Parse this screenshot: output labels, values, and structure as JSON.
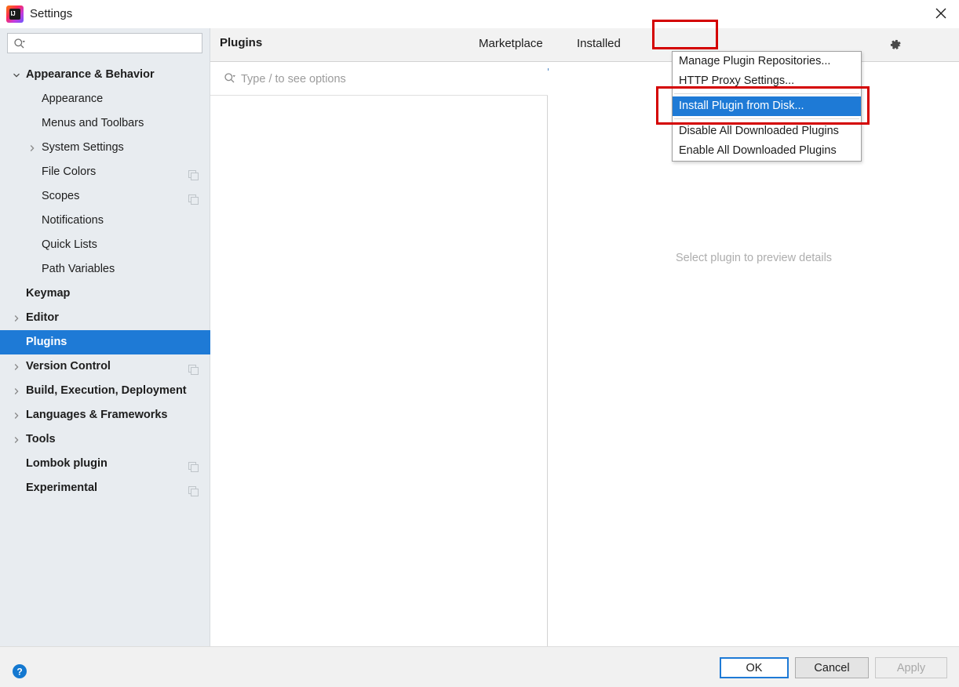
{
  "window": {
    "title": "Settings",
    "logo_icon": "intellij-idea-logo",
    "close_icon": "close-icon"
  },
  "sidebar": {
    "search": {
      "value": "",
      "placeholder": "",
      "icon": "search-icon"
    },
    "items": [
      {
        "label": "Appearance & Behavior",
        "bold": true,
        "indent": 33,
        "arrow": "down",
        "copy": false,
        "selected": false
      },
      {
        "label": "Appearance",
        "bold": false,
        "indent": 53,
        "arrow": "none",
        "copy": false,
        "selected": false
      },
      {
        "label": "Menus and Toolbars",
        "bold": false,
        "indent": 53,
        "arrow": "none",
        "copy": false,
        "selected": false
      },
      {
        "label": "System Settings",
        "bold": false,
        "indent": 53,
        "arrow": "right",
        "copy": false,
        "selected": false
      },
      {
        "label": "File Colors",
        "bold": false,
        "indent": 53,
        "arrow": "none",
        "copy": true,
        "selected": false
      },
      {
        "label": "Scopes",
        "bold": false,
        "indent": 53,
        "arrow": "none",
        "copy": true,
        "selected": false
      },
      {
        "label": "Notifications",
        "bold": false,
        "indent": 53,
        "arrow": "none",
        "copy": false,
        "selected": false
      },
      {
        "label": "Quick Lists",
        "bold": false,
        "indent": 53,
        "arrow": "none",
        "copy": false,
        "selected": false
      },
      {
        "label": "Path Variables",
        "bold": false,
        "indent": 53,
        "arrow": "none",
        "copy": false,
        "selected": false
      },
      {
        "label": "Keymap",
        "bold": true,
        "indent": 33,
        "arrow": "none",
        "copy": false,
        "selected": false
      },
      {
        "label": "Editor",
        "bold": true,
        "indent": 33,
        "arrow": "right",
        "copy": false,
        "selected": false
      },
      {
        "label": "Plugins",
        "bold": true,
        "indent": 33,
        "arrow": "none",
        "copy": false,
        "selected": true
      },
      {
        "label": "Version Control",
        "bold": true,
        "indent": 33,
        "arrow": "right",
        "copy": true,
        "selected": false
      },
      {
        "label": "Build, Execution, Deployment",
        "bold": true,
        "indent": 33,
        "arrow": "right",
        "copy": false,
        "selected": false
      },
      {
        "label": "Languages & Frameworks",
        "bold": true,
        "indent": 33,
        "arrow": "right",
        "copy": false,
        "selected": false
      },
      {
        "label": "Tools",
        "bold": true,
        "indent": 33,
        "arrow": "right",
        "copy": false,
        "selected": false
      },
      {
        "label": "Lombok plugin",
        "bold": true,
        "indent": 33,
        "arrow": "none",
        "copy": true,
        "selected": false
      },
      {
        "label": "Experimental",
        "bold": true,
        "indent": 33,
        "arrow": "none",
        "copy": true,
        "selected": false
      }
    ]
  },
  "plugins": {
    "header_title": "Plugins",
    "tabs": [
      {
        "label": "Marketplace",
        "active": true
      },
      {
        "label": "Installed",
        "active": false
      }
    ],
    "gear_icon": "gear-icon",
    "search": {
      "value": "",
      "placeholder": "Type / to see options",
      "icon": "search-icon"
    },
    "loading_icon": "loading-spinner-icon",
    "detail_message": "Select plugin to preview details"
  },
  "gear_menu": {
    "items": [
      {
        "label": "Manage Plugin Repositories...",
        "highlighted": false,
        "separator_after": false
      },
      {
        "label": "HTTP Proxy Settings...",
        "highlighted": false,
        "separator_after": true
      },
      {
        "label": "Install Plugin from Disk...",
        "highlighted": true,
        "separator_after": true
      },
      {
        "label": "Disable All Downloaded Plugins",
        "highlighted": false,
        "separator_after": false
      },
      {
        "label": "Enable All Downloaded Plugins",
        "highlighted": false,
        "separator_after": false
      }
    ]
  },
  "footer": {
    "help_icon": "help-icon",
    "ok_label": "OK",
    "cancel_label": "Cancel",
    "apply_label": "Apply"
  },
  "colors": {
    "accent": "#1e7ad6",
    "sidebar_bg": "#e8ecf0",
    "annotation": "#d40000",
    "tab_underline": "#4b86c7",
    "placeholder": "#9b9b9b"
  },
  "annotations": [
    {
      "name": "gear-button-highlight"
    },
    {
      "name": "install-plugin-from-disk-highlight"
    }
  ]
}
